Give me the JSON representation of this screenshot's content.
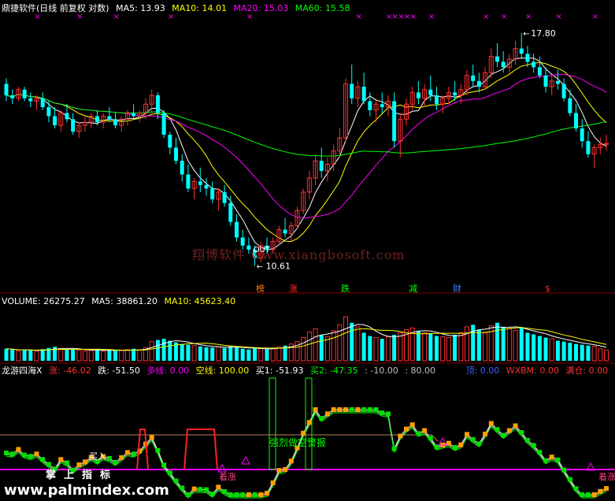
{
  "header_main": {
    "title": "鼎捷软件(日线 前复权 对数)",
    "ma": [
      {
        "label": "MA5: 13.93",
        "color": "#ffffff"
      },
      {
        "label": "MA10: 14.01",
        "color": "#ffff00"
      },
      {
        "label": "MA20: 15.03",
        "color": "#ff00ff"
      },
      {
        "label": "MA60: 15.58",
        "color": "#00ff00"
      }
    ]
  },
  "header_volume": {
    "items": [
      {
        "label": "VOLUME: 26275.27",
        "color": "#ffffff"
      },
      {
        "label": "MA5: 38861.20",
        "color": "#ffffff"
      },
      {
        "label": "MA10: 45623.40",
        "color": "#ffff00"
      }
    ]
  },
  "header_indicator": {
    "items": [
      {
        "label": "龙游四海X",
        "color": "#ffffff"
      },
      {
        "label": "涨: -46.02",
        "color": "#ff3030"
      },
      {
        "label": "跌: -51.50",
        "color": "#ffffff"
      },
      {
        "label": "多线: 0.00",
        "color": "#ff00ff"
      },
      {
        "label": "空线: 100.00",
        "color": "#ffff00"
      },
      {
        "label": "买1: -51.93",
        "color": "#ffffff"
      },
      {
        "label": "买2: -47.35",
        "color": "#00ff00"
      },
      {
        "label": ": -10.00",
        "color": "#c0c0c0"
      },
      {
        "label": ": 80.00",
        "color": "#c0c0c0"
      },
      {
        "label": "顶: 0.00",
        "color": "#4060ff"
      },
      {
        "label": "WXBM: 0.00",
        "color": "#ff3030"
      },
      {
        "label": "满仓: 0.00",
        "color": "#ff3030"
      }
    ]
  },
  "annotations": {
    "high": "17.80",
    "low": "10.61",
    "out": "OUT",
    "buy": "买入",
    "signal": "强烈做空警报",
    "bottom_left": "着涨",
    "bottom_right": "着涨",
    "zsg": "掌上指标",
    "markers": [
      {
        "text": "榜",
        "color": "#ff8000"
      },
      {
        "text": "涨",
        "color": "#ff3030"
      },
      {
        "text": "跌",
        "color": "#00ff00"
      },
      {
        "text": "减",
        "color": "#00ff00"
      },
      {
        "text": "财",
        "color": "#4080ff"
      },
      {
        "text": "$",
        "color": "#ff2020"
      }
    ]
  },
  "watermark": "翔博软件 www.xiangbosoft.com",
  "bottom_watermark": "www.palmindex.com",
  "chart_data": [
    {
      "type": "candlestick",
      "title": "鼎捷软件(日线 前复权 对数)",
      "scale": "log",
      "ylim": [
        10.2,
        18.5
      ],
      "up_color": "#ff3030",
      "down_color": "#00ffff",
      "ohlc": [
        [
          15.9,
          16.1,
          15.3,
          15.5
        ],
        [
          15.5,
          15.7,
          15.2,
          15.4
        ],
        [
          15.4,
          15.8,
          15.3,
          15.7
        ],
        [
          15.7,
          15.8,
          15.3,
          15.4
        ],
        [
          15.4,
          15.6,
          15.1,
          15.3
        ],
        [
          15.3,
          15.5,
          15.0,
          15.4
        ],
        [
          15.4,
          15.6,
          15.0,
          15.1
        ],
        [
          15.1,
          15.3,
          14.6,
          14.8
        ],
        [
          14.8,
          15.1,
          14.4,
          14.5
        ],
        [
          14.5,
          15.0,
          14.3,
          14.9
        ],
        [
          14.9,
          15.2,
          14.6,
          14.7
        ],
        [
          14.7,
          14.9,
          14.2,
          14.3
        ],
        [
          14.3,
          14.6,
          14.1,
          14.5
        ],
        [
          14.5,
          14.8,
          14.3,
          14.6
        ],
        [
          14.6,
          14.9,
          14.4,
          14.8
        ],
        [
          14.8,
          15.0,
          14.5,
          14.6
        ],
        [
          14.6,
          14.9,
          14.4,
          14.8
        ],
        [
          14.8,
          15.1,
          14.6,
          14.7
        ],
        [
          14.7,
          14.9,
          14.4,
          14.5
        ],
        [
          14.5,
          14.8,
          14.3,
          14.7
        ],
        [
          14.7,
          15.0,
          14.5,
          14.9
        ],
        [
          14.9,
          15.2,
          14.7,
          14.8
        ],
        [
          14.8,
          15.0,
          14.6,
          14.9
        ],
        [
          14.9,
          15.4,
          14.7,
          15.2
        ],
        [
          15.2,
          15.7,
          14.9,
          15.5
        ],
        [
          15.5,
          15.6,
          14.7,
          14.9
        ],
        [
          14.9,
          15.0,
          14.1,
          14.2
        ],
        [
          14.2,
          14.3,
          13.6,
          13.8
        ],
        [
          13.8,
          14.1,
          13.3,
          13.4
        ],
        [
          13.4,
          13.6,
          12.8,
          13.0
        ],
        [
          13.0,
          13.3,
          12.5,
          12.6
        ],
        [
          12.6,
          12.9,
          12.3,
          12.8
        ],
        [
          12.8,
          13.2,
          12.5,
          12.7
        ],
        [
          12.7,
          12.9,
          12.4,
          12.6
        ],
        [
          12.6,
          12.8,
          12.2,
          12.3
        ],
        [
          12.3,
          12.6,
          12.0,
          12.5
        ],
        [
          12.5,
          12.7,
          12.1,
          12.2
        ],
        [
          12.2,
          12.4,
          11.6,
          11.7
        ],
        [
          11.7,
          11.9,
          11.2,
          11.3
        ],
        [
          11.3,
          11.5,
          11.0,
          11.1
        ],
        [
          11.1,
          11.3,
          10.9,
          11.0
        ],
        [
          11.0,
          11.1,
          10.61,
          10.8
        ],
        [
          10.8,
          11.2,
          10.7,
          11.1
        ],
        [
          11.1,
          11.3,
          10.9,
          11.0
        ],
        [
          11.0,
          11.3,
          10.9,
          11.2
        ],
        [
          11.2,
          11.6,
          11.1,
          11.5
        ],
        [
          11.5,
          11.8,
          11.3,
          11.4
        ],
        [
          11.4,
          11.7,
          11.2,
          11.6
        ],
        [
          11.6,
          12.1,
          11.5,
          12.0
        ],
        [
          12.0,
          12.6,
          11.9,
          12.5
        ],
        [
          12.5,
          13.1,
          12.3,
          12.9
        ],
        [
          12.9,
          13.6,
          12.7,
          13.4
        ],
        [
          13.4,
          13.8,
          12.9,
          13.1
        ],
        [
          13.1,
          13.5,
          12.8,
          13.3
        ],
        [
          13.3,
          13.9,
          13.1,
          13.7
        ],
        [
          13.7,
          14.4,
          13.5,
          14.1
        ],
        [
          14.1,
          16.1,
          14.0,
          15.9
        ],
        [
          15.9,
          16.6,
          15.2,
          15.4
        ],
        [
          15.4,
          16.0,
          15.1,
          15.8
        ],
        [
          15.8,
          16.3,
          15.2,
          15.3
        ],
        [
          15.3,
          15.6,
          14.8,
          15.0
        ],
        [
          15.0,
          15.4,
          14.6,
          15.2
        ],
        [
          15.2,
          15.6,
          14.9,
          15.1
        ],
        [
          15.1,
          15.5,
          14.8,
          15.3
        ],
        [
          15.3,
          15.6,
          13.8,
          14.0
        ],
        [
          14.0,
          14.9,
          13.5,
          14.7
        ],
        [
          14.7,
          15.4,
          14.5,
          15.2
        ],
        [
          15.2,
          15.8,
          15.0,
          15.6
        ],
        [
          15.6,
          16.0,
          15.2,
          15.4
        ],
        [
          15.4,
          15.9,
          15.1,
          15.7
        ],
        [
          15.7,
          16.2,
          15.3,
          15.5
        ],
        [
          15.5,
          15.8,
          15.0,
          15.2
        ],
        [
          15.2,
          15.5,
          14.9,
          15.4
        ],
        [
          15.4,
          15.8,
          15.2,
          15.6
        ],
        [
          15.6,
          16.0,
          15.3,
          15.5
        ],
        [
          15.5,
          15.9,
          15.2,
          15.7
        ],
        [
          15.7,
          16.4,
          15.5,
          16.2
        ],
        [
          16.2,
          16.6,
          15.8,
          16.0
        ],
        [
          16.0,
          16.3,
          15.6,
          15.8
        ],
        [
          15.8,
          16.5,
          15.7,
          16.3
        ],
        [
          16.3,
          17.2,
          16.1,
          16.9
        ],
        [
          16.9,
          17.4,
          16.5,
          16.7
        ],
        [
          16.7,
          17.1,
          16.3,
          16.5
        ],
        [
          16.5,
          17.0,
          16.2,
          16.8
        ],
        [
          16.8,
          17.5,
          16.6,
          17.2
        ],
        [
          17.2,
          17.8,
          16.8,
          17.0
        ],
        [
          17.0,
          17.3,
          16.5,
          16.7
        ],
        [
          16.7,
          17.0,
          16.3,
          16.5
        ],
        [
          16.5,
          16.9,
          16.1,
          16.2
        ],
        [
          16.2,
          16.5,
          15.6,
          15.8
        ],
        [
          15.8,
          16.2,
          15.5,
          16.0
        ],
        [
          16.0,
          16.4,
          15.7,
          15.9
        ],
        [
          15.9,
          16.1,
          15.3,
          15.4
        ],
        [
          15.4,
          15.7,
          14.8,
          14.9
        ],
        [
          14.9,
          15.2,
          14.3,
          14.4
        ],
        [
          14.4,
          14.7,
          13.8,
          14.0
        ],
        [
          14.0,
          14.3,
          13.5,
          13.6
        ],
        [
          13.6,
          13.9,
          13.2,
          13.8
        ],
        [
          13.8,
          14.1,
          13.6,
          13.9
        ],
        [
          13.9,
          14.2,
          13.7,
          13.93
        ]
      ]
    },
    {
      "type": "bar",
      "title": "VOLUME",
      "ylim": [
        0,
        130000
      ],
      "values": [
        30000,
        28000,
        25000,
        27000,
        26000,
        24000,
        29000,
        32000,
        35000,
        31000,
        28000,
        30000,
        27000,
        25000,
        26000,
        28000,
        24000,
        27000,
        25000,
        26000,
        28000,
        30000,
        27000,
        33000,
        48000,
        52000,
        55000,
        50000,
        46000,
        42000,
        40000,
        38000,
        36000,
        34000,
        33000,
        35000,
        32000,
        36000,
        34000,
        30000,
        28000,
        32000,
        30000,
        29000,
        31000,
        35000,
        38000,
        42000,
        48000,
        58000,
        72000,
        80000,
        65000,
        60000,
        75000,
        90000,
        110000,
        95000,
        85000,
        70000,
        62000,
        58000,
        55000,
        60000,
        65000,
        70000,
        78000,
        82000,
        75000,
        70000,
        68000,
        62000,
        60000,
        58000,
        65000,
        70000,
        85000,
        90000,
        78000,
        72000,
        88000,
        95000,
        85000,
        80000,
        76000,
        82000,
        70000,
        66000,
        62000,
        58000,
        55000,
        50000,
        48000,
        45000,
        42000,
        40000,
        38000,
        36000,
        30000,
        26275
      ]
    }
  ]
}
